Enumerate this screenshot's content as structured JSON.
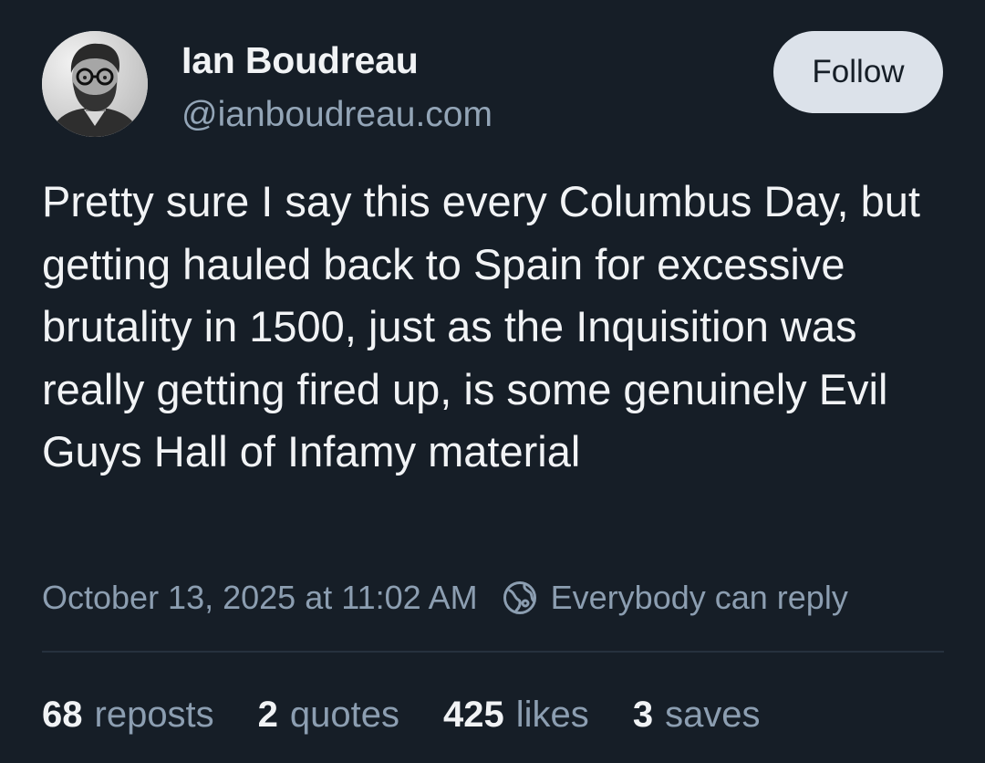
{
  "author": {
    "display_name": "Ian Boudreau",
    "handle": "@ianboudreau.com"
  },
  "follow_label": "Follow",
  "post": {
    "text": "Pretty sure I say this every Columbus Day, but getting hauled back to Spain for excessive brutality in 1500, just as the Inquisition was really getting fired up, is some genuinely Evil Guys Hall of Infamy material",
    "timestamp": "October 13, 2025 at 11:02 AM",
    "reply_setting": "Everybody can reply"
  },
  "stats": [
    {
      "count": "68",
      "label": "reposts"
    },
    {
      "count": "2",
      "label": "quotes"
    },
    {
      "count": "425",
      "label": "likes"
    },
    {
      "count": "3",
      "label": "saves"
    }
  ],
  "icons": {
    "reply_setting_icon": "globe-icon",
    "avatar": "avatar"
  },
  "colors": {
    "background": "#161e27",
    "text_primary": "#f1f3f5",
    "text_secondary": "#8c9eb1",
    "follow_button_bg": "#dce2ea"
  }
}
